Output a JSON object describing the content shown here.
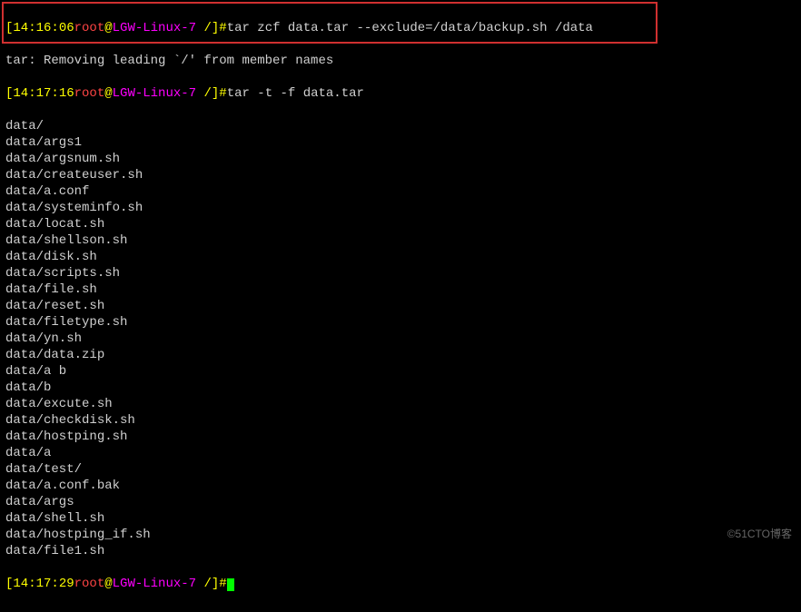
{
  "prompts": [
    {
      "time": "14:16:06",
      "user": "root",
      "host": "LGW-Linux-7",
      "path": "/",
      "cmd": "tar zcf data.tar --exclude=/data/backup.sh /data"
    },
    {
      "time": "14:17:16",
      "user": "root",
      "host": "LGW-Linux-7",
      "path": "/",
      "cmd": "tar -t -f data.tar"
    },
    {
      "time": "14:17:29",
      "user": "root",
      "host": "LGW-Linux-7",
      "path": "/",
      "cmd": ""
    }
  ],
  "tar_msg": "tar: Removing leading `/' from member names",
  "listing": [
    "data/",
    "data/args1",
    "data/argsnum.sh",
    "data/createuser.sh",
    "data/a.conf",
    "data/systeminfo.sh",
    "data/locat.sh",
    "data/shellson.sh",
    "data/disk.sh",
    "data/scripts.sh",
    "data/file.sh",
    "data/reset.sh",
    "data/filetype.sh",
    "data/yn.sh",
    "data/data.zip",
    "data/a b",
    "data/b",
    "data/excute.sh",
    "data/checkdisk.sh",
    "data/hostping.sh",
    "data/a",
    "data/test/",
    "data/a.conf.bak",
    "data/args",
    "data/shell.sh",
    "data/hostping_if.sh",
    "data/file1.sh"
  ],
  "watermark": "©51CTO博客"
}
